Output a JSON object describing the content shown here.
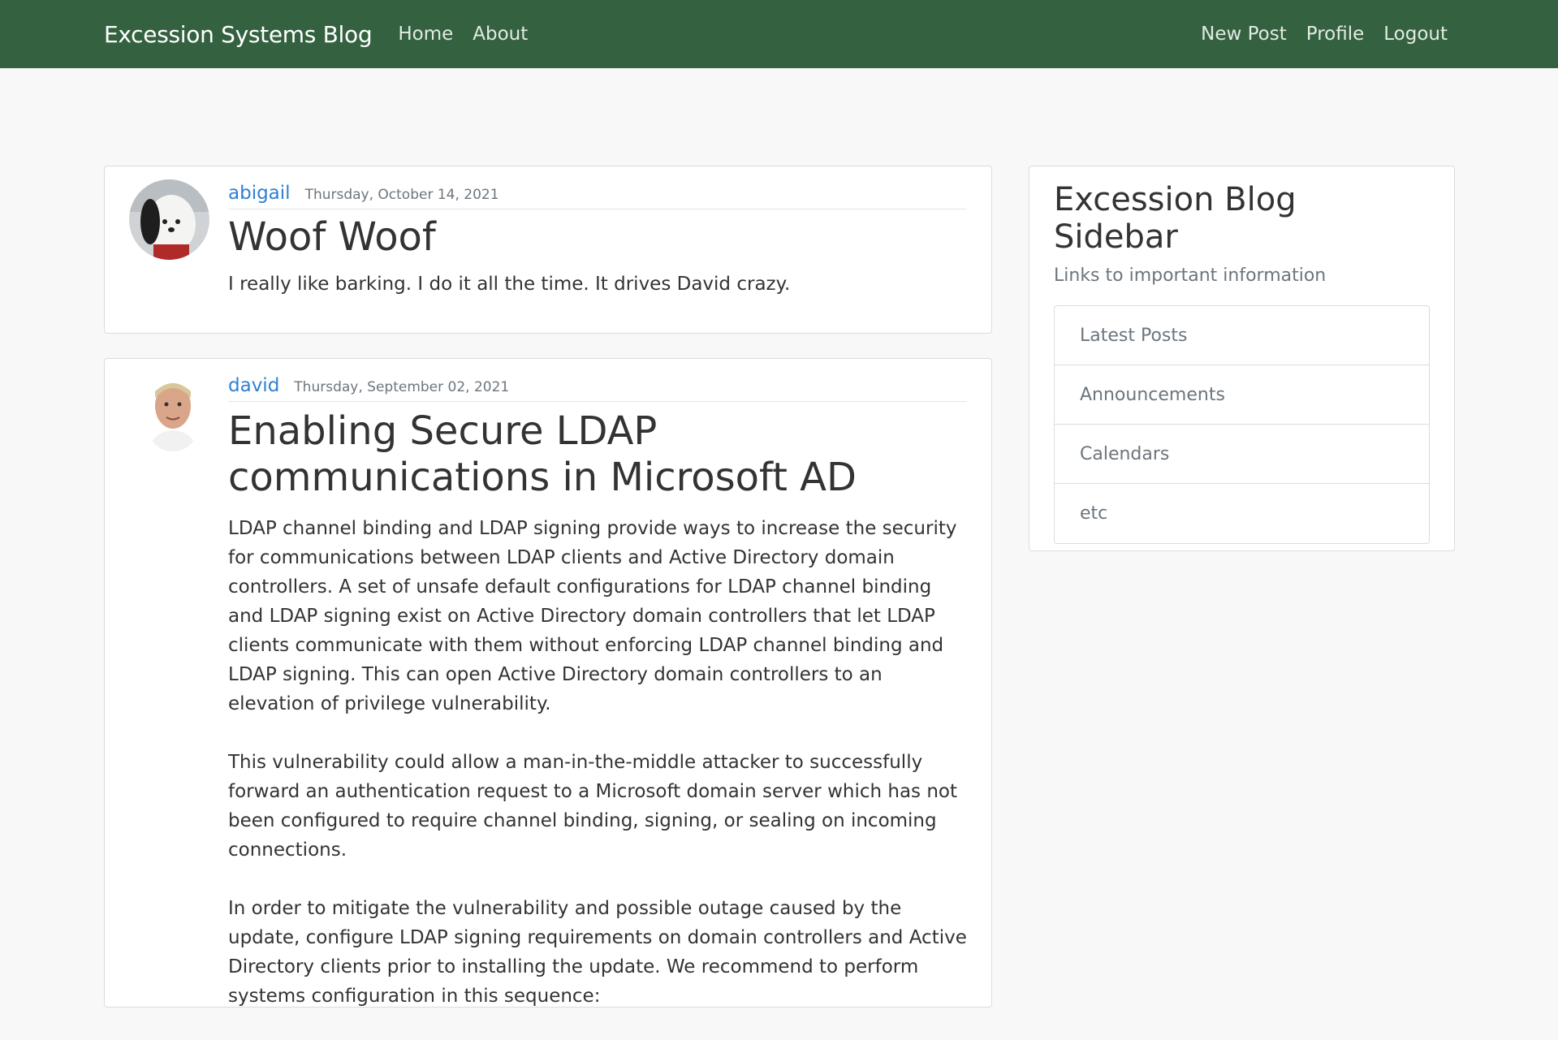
{
  "navbar": {
    "brand": "Excession Systems Blog",
    "left_links": [
      "Home",
      "About"
    ],
    "right_links": [
      "New Post",
      "Profile",
      "Logout"
    ],
    "color": "#346240"
  },
  "posts": [
    {
      "author": "abigail",
      "date": "Thursday, October 14, 2021",
      "title": "Woof Woof",
      "paragraphs": [
        "I really like barking. I do it all the time. It drives David crazy."
      ]
    },
    {
      "author": "david",
      "date": "Thursday, September 02, 2021",
      "title": "Enabling Secure LDAP communications in Microsoft AD",
      "paragraphs": [
        "LDAP channel binding and LDAP signing provide ways to increase the security for communications between LDAP clients and Active Directory domain controllers. A set of unsafe default configurations for LDAP channel binding and LDAP signing exist on Active Directory domain controllers that let LDAP clients communicate with them without enforcing LDAP channel binding and LDAP signing. This can open Active Directory domain controllers to an elevation of privilege vulnerability.",
        "This vulnerability could allow a man-in-the-middle attacker to successfully forward an authentication request to a Microsoft domain server which has not been configured to require channel binding, signing, or sealing on incoming connections.",
        "In order to mitigate the vulnerability and possible outage caused by the update, configure LDAP signing requirements on domain controllers and Active Directory clients prior to installing the update. We recommend to perform systems configuration in this sequence:"
      ]
    }
  ],
  "sidebar": {
    "title": "Excession Blog Sidebar",
    "subtitle": "Links to important information",
    "items": [
      "Latest Posts",
      "Announcements",
      "Calendars",
      "etc"
    ]
  }
}
